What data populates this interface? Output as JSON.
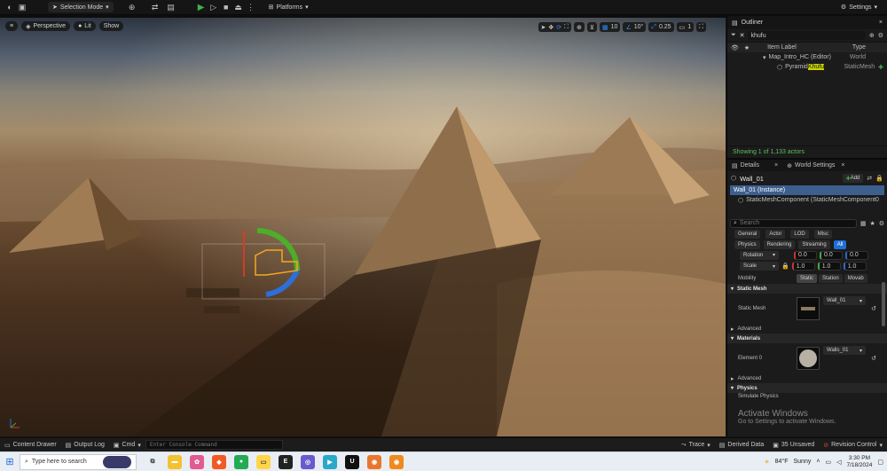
{
  "toolbar": {
    "selection_mode": "Selection Mode",
    "platforms": "Platforms",
    "settings": "Settings"
  },
  "viewport": {
    "perspective": "Perspective",
    "lit": "Lit",
    "show": "Show",
    "grid_snap": "10",
    "rotation_snap": "10°",
    "scale_snap": "0.25",
    "camera_speed": "1"
  },
  "outliner": {
    "tab": "Outliner",
    "search_value": "khufu",
    "col_item_label": "Item Label",
    "col_type": "Type",
    "rows": [
      {
        "label": "Map_Intro_HC (Editor)",
        "type": "World"
      },
      {
        "label_prefix": "Pyramid",
        "label_highlight": "Khufu",
        "type": "StaticMesh"
      }
    ],
    "status": "Showing 1 of 1,133 actors"
  },
  "details": {
    "tab": "Details",
    "world_settings_tab": "World Settings",
    "actor_name": "Wall_01",
    "add_label": "Add",
    "instance_label": "Wall_01 (Instance)",
    "component_label": "StaticMeshComponent (StaticMeshComponent0",
    "search_placeholder": "Search",
    "filters_row1": [
      "General",
      "Actor",
      "LOD",
      "Misc"
    ],
    "filters_row2": [
      "Physics",
      "Rendering",
      "Streaming",
      "All"
    ],
    "rotation_label": "Rotation",
    "rotation_values": [
      "0.0",
      "0.0",
      "0.0"
    ],
    "scale_label": "Scale",
    "scale_values": [
      "1.0",
      "1.0",
      "1.0"
    ],
    "mobility_label": "Mobility",
    "mobility_options": [
      "Static",
      "Station",
      "Movab"
    ],
    "static_mesh_section": "Static Mesh",
    "static_mesh_label": "Static Mesh",
    "static_mesh_value": "Wall_01",
    "advanced_label": "Advanced",
    "materials_section": "Materials",
    "element0_label": "Element 0",
    "element0_value": "Walls_01",
    "advanced2_label": "Advanced",
    "physics_section": "Physics",
    "simulate_physics": "Simulate Physics"
  },
  "watermark": {
    "title": "Activate Windows",
    "subtitle": "Go to Settings to activate Windows."
  },
  "bottombar": {
    "content_drawer": "Content Drawer",
    "output_log": "Output Log",
    "cmd": "Cmd",
    "console_placeholder": "Enter Console Command",
    "trace": "Trace",
    "derived_data": "Derived Data",
    "unsaved": "35 Unsaved",
    "revision_control": "Revision Control"
  },
  "taskbar": {
    "search_placeholder": "Type here to search",
    "weather_temp": "84°F",
    "weather_desc": "Sunny",
    "time": "3:30 PM",
    "date": "7/18/2024"
  },
  "colors": {
    "accent_blue": "#1f6fd6",
    "play_green": "#44b04a",
    "highlight_yellow": "#c9d400"
  }
}
